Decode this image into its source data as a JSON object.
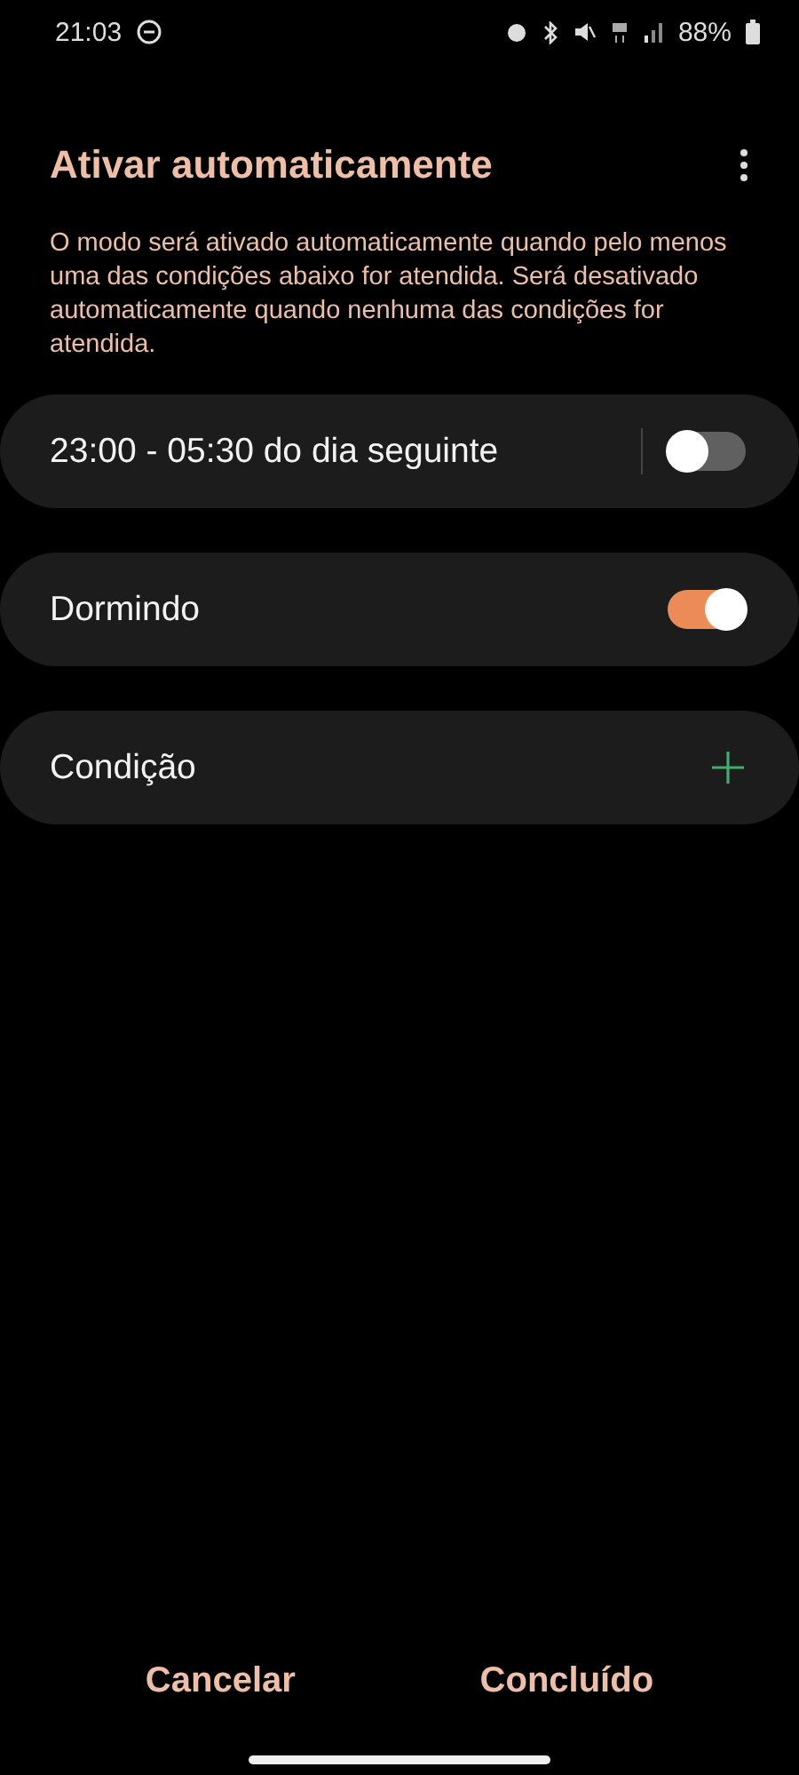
{
  "status_bar": {
    "time": "21:03",
    "battery": "88%"
  },
  "header": {
    "title": "Ativar automaticamente"
  },
  "description": "O modo será ativado automaticamente quando pelo menos uma das condições abaixo for atendida. Será desativado automaticamente quando nenhuma das condições for atendida.",
  "conditions": [
    {
      "kind": "split-toggle",
      "label": "23:00 - 05:30 do dia seguinte",
      "on": false
    },
    {
      "kind": "toggle",
      "label": "Dormindo",
      "on": true
    },
    {
      "kind": "add",
      "label": "Condição"
    }
  ],
  "buttons": [
    "Cancelar",
    "Concluído"
  ]
}
